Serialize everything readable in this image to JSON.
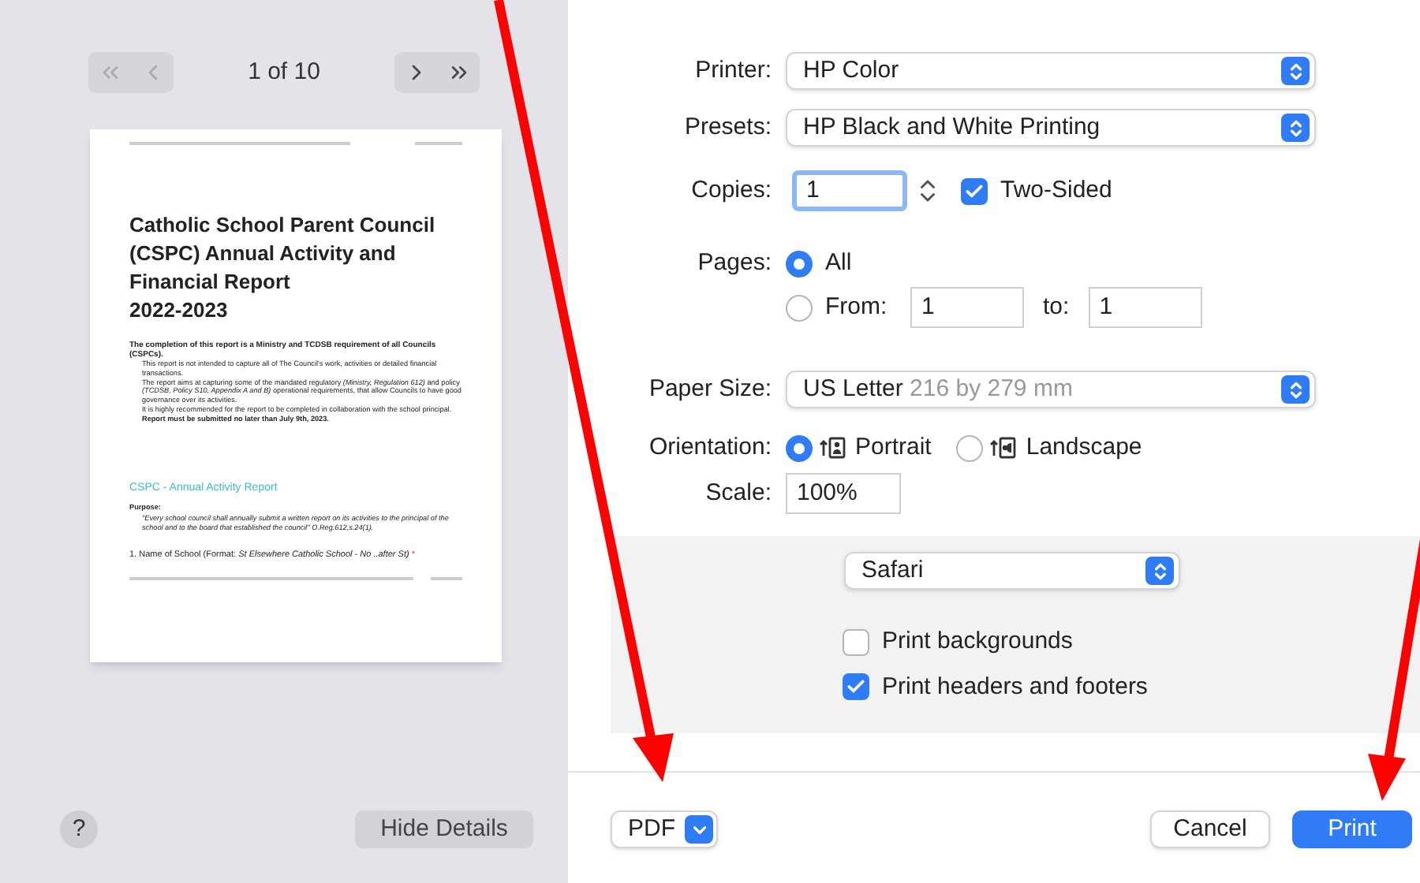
{
  "preview": {
    "nav": [
      {
        "kind": "first",
        "disabled": true
      },
      {
        "kind": "previous",
        "disabled": true
      },
      {
        "kind": "next",
        "disabled": false
      },
      {
        "kind": "last",
        "disabled": false
      }
    ],
    "page_indicator": "1 of 10",
    "document": {
      "title": [
        "Catholic School Parent Council",
        "(CSPC)  Annual Activity and",
        "Financial Report",
        "2022-2023"
      ],
      "intro": "The completion of this report is a Ministry and TCDSB requirement of all Councils (CSPCs).",
      "bullets": [
        {
          "text": "This report is not intended to capture all of The Council's work, activities or detailed financial transactions.",
          "bold": false
        },
        {
          "text": "The report aims at capturing some of the mandated regulatory  *(Ministry, Regulation 612)* and policy *(TCDSB, Policy S10, Appendix A and B)* operational requirements, that allow Councils to have good governance over its activities.",
          "bold": false
        },
        {
          "text": "It is highly recommended for the report to be completed in collaboration with the school principal.",
          "bold": false
        },
        {
          "text": "Report must be submitted no later than July 9th, 2023.",
          "bold": true
        }
      ],
      "section_heading": "CSPC - Annual Activity Report",
      "purpose_label": "Purpose:",
      "purpose_quote": "\"Every school council shall annually submit a written report on its activities to the principal of the school and to the board that established the council\" O.Reg.612,s.24(1).",
      "question": "1. Name of School (Format:  *St Elsewhere Catholic School - No ..after St)*",
      "required_mark": "*"
    }
  },
  "help_button": "?",
  "hide_details_button": "Hide Details",
  "form": {
    "printer": {
      "label": "Printer:",
      "value": "HP Color"
    },
    "presets": {
      "label": "Presets:",
      "value": "HP Black and White Printing"
    },
    "copies": {
      "label": "Copies:",
      "value": "1",
      "two_sided": {
        "label": "Two-Sided",
        "checked": true
      }
    },
    "pages": {
      "label": "Pages:",
      "options": [
        {
          "label": "All",
          "selected": true
        },
        {
          "label": "From:",
          "selected": false
        }
      ],
      "from": "1",
      "to_label": "to:",
      "to": "1"
    },
    "paper_size": {
      "label": "Paper Size:",
      "value": "US Letter",
      "detail": "216 by 279 mm"
    },
    "orientation": {
      "label": "Orientation:",
      "options": [
        {
          "label": "Portrait",
          "selected": true,
          "kind": "portrait"
        },
        {
          "label": "Landscape",
          "selected": false,
          "kind": "landscape"
        }
      ]
    },
    "scale": {
      "label": "Scale:",
      "value": "100%"
    }
  },
  "section": {
    "menu": "Safari",
    "options": [
      {
        "label": "Print backgrounds",
        "checked": false
      },
      {
        "label": "Print headers and footers",
        "checked": true
      }
    ]
  },
  "footer": {
    "pdf": "PDF",
    "buttons": [
      {
        "label": "Cancel",
        "kind": "default"
      },
      {
        "label": "Print",
        "kind": "primary"
      }
    ]
  }
}
